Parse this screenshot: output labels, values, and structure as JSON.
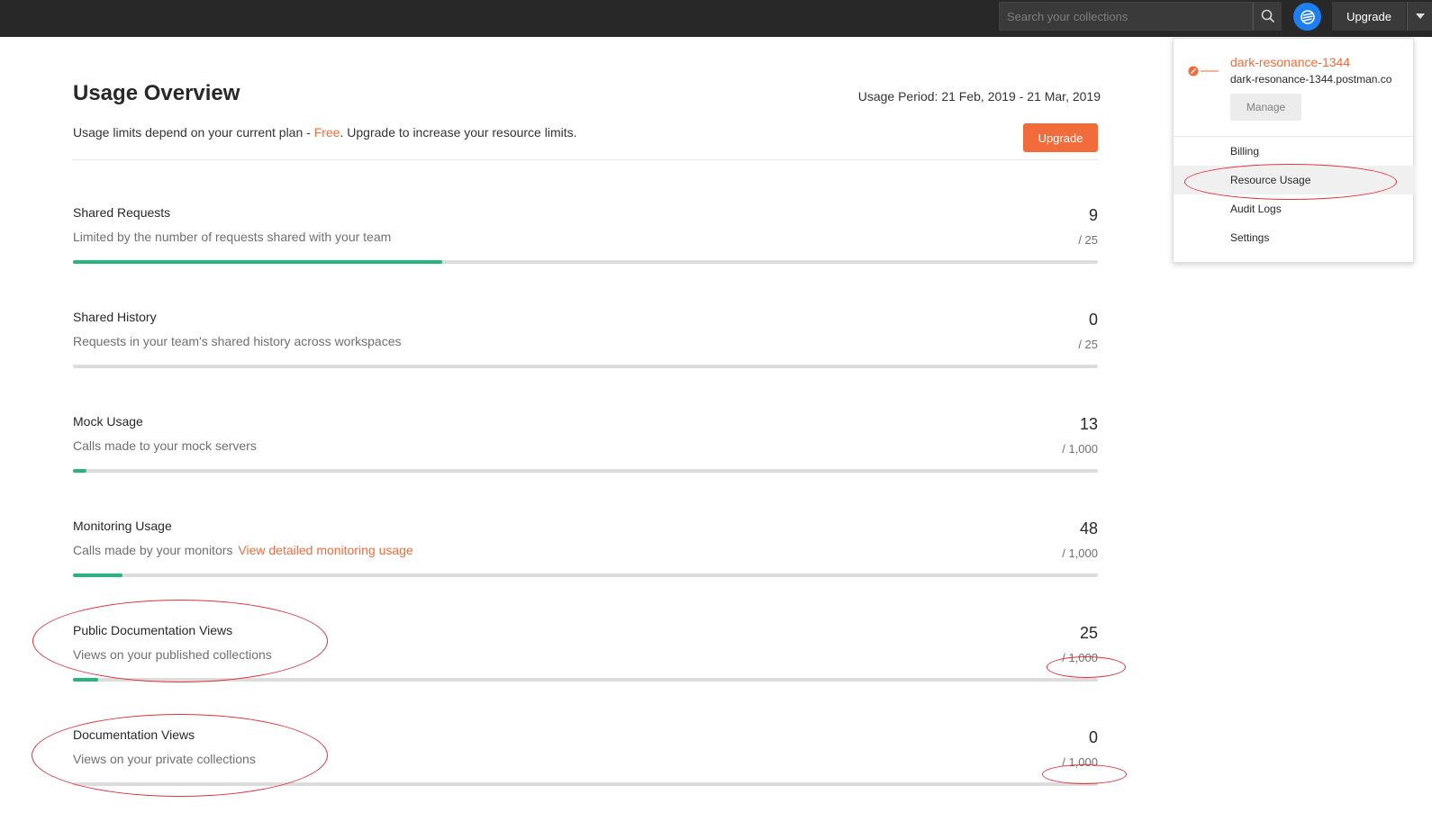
{
  "topbar": {
    "search_placeholder": "Search your collections",
    "search_icon": "search-icon",
    "avatar_icon": "satellite-icon",
    "upgrade_label": "Upgrade",
    "caret_icon": "caret-down-icon"
  },
  "page": {
    "title": "Usage Overview",
    "period": "Usage Period:  21 Feb, 2019 - 21 Mar, 2019",
    "limits_prefix": "Usage limits depend on your current plan - ",
    "plan": "Free",
    "limits_suffix": ". Upgrade to increase your resource limits.",
    "upgrade_label": "Upgrade"
  },
  "usage": [
    {
      "title": "Shared Requests",
      "desc": "Limited by the number of requests shared with your team",
      "link": "",
      "count": "9",
      "limit": "/ 25",
      "fraction": 0.36
    },
    {
      "title": "Shared History",
      "desc": "Requests in your team's shared history across workspaces",
      "link": "",
      "count": "0",
      "limit": "/ 25",
      "fraction": 0
    },
    {
      "title": "Mock Usage",
      "desc": "Calls made to your mock servers",
      "link": "",
      "count": "13",
      "limit": "/ 1,000",
      "fraction": 0.013
    },
    {
      "title": "Monitoring Usage",
      "desc": "Calls made by your monitors",
      "link": "View detailed monitoring usage",
      "count": "48",
      "limit": "/ 1,000",
      "fraction": 0.048
    },
    {
      "title": "Public Documentation Views",
      "desc": "Views on your published collections",
      "link": "",
      "count": "25",
      "limit": "/ 1,000",
      "fraction": 0.025
    },
    {
      "title": "Documentation Views",
      "desc": "Views on your private collections",
      "link": "",
      "count": "0",
      "limit": "/ 1,000",
      "fraction": 0
    }
  ],
  "dropdown": {
    "team_name": "dark-resonance-1344",
    "team_domain": "dark-resonance-1344.postman.co",
    "manage_label": "Manage",
    "items": [
      {
        "label": "Billing",
        "active": false
      },
      {
        "label": "Resource Usage",
        "active": true
      },
      {
        "label": "Audit Logs",
        "active": false
      },
      {
        "label": "Settings",
        "active": false
      }
    ]
  },
  "colors": {
    "accent": "#f26b3a",
    "progress": "#26b47f",
    "annotation": "#e0303a"
  }
}
